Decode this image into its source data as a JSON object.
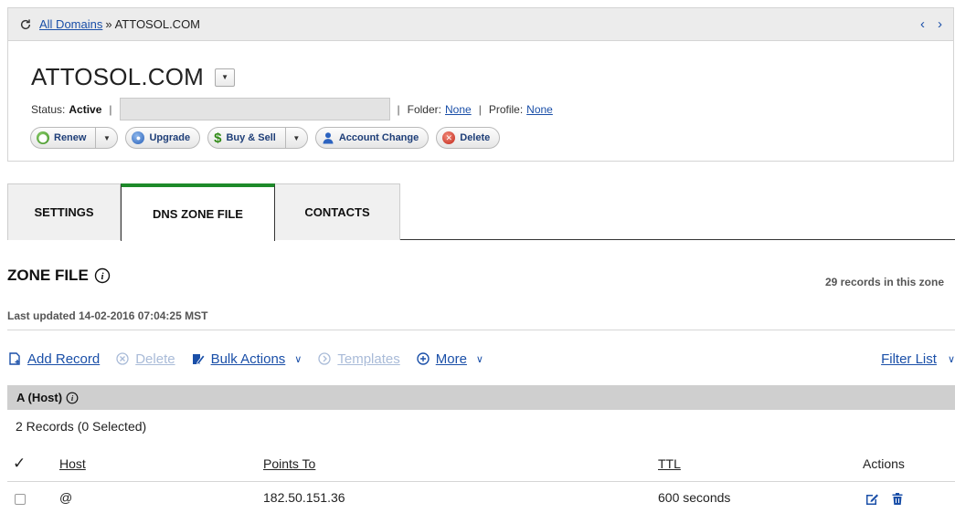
{
  "breadcrumb": {
    "link_label": "All Domains",
    "separator": "»",
    "current": "ATTOSOL.COM",
    "prev_icon": "chevron-left-icon",
    "next_icon": "chevron-right-icon"
  },
  "domain": {
    "name": "ATTOSOL.COM",
    "status_label": "Status:",
    "status_value": "Active",
    "folder_label": "Folder:",
    "folder_value": "None",
    "profile_label": "Profile:",
    "profile_value": "None"
  },
  "actions": {
    "renew": "Renew",
    "upgrade": "Upgrade",
    "buy_sell": "Buy & Sell",
    "account_change": "Account Change",
    "delete": "Delete",
    "dollar_symbol": "$"
  },
  "tabs": [
    {
      "label": "SETTINGS",
      "active": false
    },
    {
      "label": "DNS ZONE FILE",
      "active": true
    },
    {
      "label": "CONTACTS",
      "active": false
    }
  ],
  "zone": {
    "title": "ZONE FILE",
    "records_count": "29 records in this zone",
    "last_updated": "Last updated 14-02-2016 07:04:25 MST"
  },
  "toolbar": {
    "add_record": "Add Record",
    "delete": "Delete",
    "bulk_actions": "Bulk Actions",
    "templates": "Templates",
    "more": "More",
    "filter_list": "Filter List"
  },
  "group": {
    "title": "A (Host)",
    "subtitle": "2 Records (0 Selected)"
  },
  "table": {
    "check_header": "✓",
    "columns": {
      "host": "Host",
      "points_to": "Points To",
      "ttl": "TTL",
      "actions": "Actions"
    },
    "rows": [
      {
        "host": "@",
        "points_to": "182.50.151.36",
        "ttl": "600 seconds"
      }
    ]
  },
  "colors": {
    "link": "#1a4fa8",
    "active_tab_accent": "#1d8a2a",
    "group_header_bg": "#cfcfcf"
  }
}
